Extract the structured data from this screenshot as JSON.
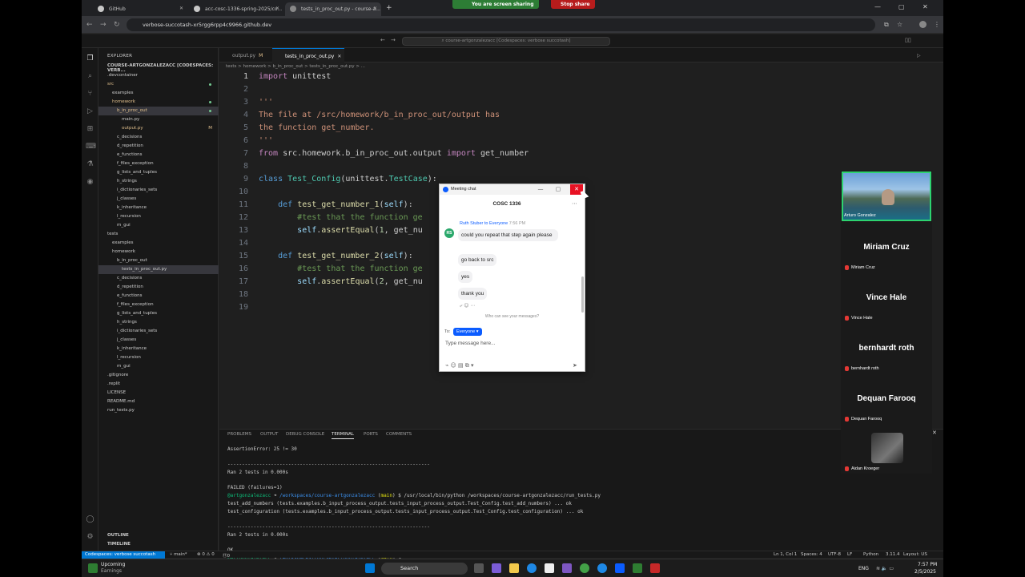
{
  "browser": {
    "tabs": [
      {
        "label": "GitHub"
      },
      {
        "label": "acc-cosc-1336-spring-2025/co..."
      },
      {
        "label": "tests_in_proc_out.py - course-a..."
      }
    ],
    "screen_share": {
      "label": "You are screen sharing",
      "stop_label": "Stop share"
    },
    "url": "verbose-succotash-xr5rgg6rpp4c9966.github.dev"
  },
  "vscode": {
    "command_center": "course-artgonzalezacc [Codespaces: verbose succotash]",
    "explorer_title": "EXPLORER",
    "workspace": "COURSE-ARTGONZALEZACC [CODESPACES: VERB...",
    "tree": [
      {
        "label": ".devcontainer",
        "indent": 0
      },
      {
        "label": "src",
        "indent": 0,
        "dot": true,
        "color": "#e2c08d"
      },
      {
        "label": "examples",
        "indent": 1
      },
      {
        "label": "homework",
        "indent": 1,
        "dot": true,
        "color": "#e2c08d"
      },
      {
        "label": "b_in_proc_out",
        "indent": 2,
        "dot": true,
        "color": "#e2c08d",
        "sel": true
      },
      {
        "label": "main.py",
        "indent": 3
      },
      {
        "label": "output.py",
        "indent": 3,
        "badge": "M",
        "color": "#e2c08d"
      },
      {
        "label": "c_decisions",
        "indent": 2
      },
      {
        "label": "d_repetition",
        "indent": 2
      },
      {
        "label": "e_functions",
        "indent": 2
      },
      {
        "label": "f_files_exception",
        "indent": 2
      },
      {
        "label": "g_lists_and_tuples",
        "indent": 2
      },
      {
        "label": "h_strings",
        "indent": 2
      },
      {
        "label": "i_dictionaries_sets",
        "indent": 2
      },
      {
        "label": "j_classes",
        "indent": 2
      },
      {
        "label": "k_inheritance",
        "indent": 2
      },
      {
        "label": "l_recursion",
        "indent": 2
      },
      {
        "label": "m_gui",
        "indent": 2
      },
      {
        "label": "tests",
        "indent": 0
      },
      {
        "label": "examples",
        "indent": 1
      },
      {
        "label": "homework",
        "indent": 1
      },
      {
        "label": "b_in_proc_out",
        "indent": 2
      },
      {
        "label": "tests_in_proc_out.py",
        "indent": 3,
        "sel": true
      },
      {
        "label": "c_decisions",
        "indent": 2
      },
      {
        "label": "d_repetition",
        "indent": 2
      },
      {
        "label": "e_functions",
        "indent": 2
      },
      {
        "label": "f_files_exception",
        "indent": 2
      },
      {
        "label": "g_lists_and_tuples",
        "indent": 2
      },
      {
        "label": "h_strings",
        "indent": 2
      },
      {
        "label": "i_dictionaries_sets",
        "indent": 2
      },
      {
        "label": "j_classes",
        "indent": 2
      },
      {
        "label": "k_inheritance",
        "indent": 2
      },
      {
        "label": "l_recursion",
        "indent": 2
      },
      {
        "label": "m_gui",
        "indent": 2
      },
      {
        "label": ".gitignore",
        "indent": 0
      },
      {
        "label": ".replit",
        "indent": 0
      },
      {
        "label": "LICENSE",
        "indent": 0
      },
      {
        "label": "README.md",
        "indent": 0
      },
      {
        "label": "run_tests.py",
        "indent": 0
      }
    ],
    "outline_label": "OUTLINE",
    "timeline_label": "TIMELINE",
    "editor_tabs": [
      {
        "label": "output.py",
        "mod": "M"
      },
      {
        "label": "tests_in_proc_out.py",
        "mod": ""
      }
    ],
    "breadcrumb": "tests > homework > b_in_proc_out > tests_in_proc_out.py > ...",
    "code_lines": [
      "<span class='kw'>import</span> unittest",
      "",
      "<span class='str'>'''</span>",
      "<span class='str'>The file at /src/homework/b_in_proc_out/output has</span>",
      "<span class='str'>the function get_number.</span>",
      "<span class='str'>'''</span>",
      "<span class='kw'>from</span> src.homework.b_in_proc_out.output <span class='kw'>import</span> get_number",
      "",
      "<span class='kw2'>class</span> <span class='cls'>Test_Config</span>(unittest.<span class='cls'>TestCase</span>):",
      "",
      "    <span class='kw2'>def</span> <span class='fn'>test_get_number_1</span>(<span class='var'>self</span>):",
      "        <span class='cm'>#test that the function ge</span>",
      "        <span class='var'>self</span>.<span class='fn'>assertEqual</span>(<span class='num'>1</span>, get_nu",
      "",
      "    <span class='kw2'>def</span> <span class='fn'>test_get_number_2</span>(<span class='var'>self</span>):",
      "        <span class='cm'>#test that the function ge</span>",
      "        <span class='var'>self</span>.<span class='fn'>assertEqual</span>(<span class='num'>2</span>, get_nu",
      "",
      ""
    ],
    "panel_tabs": [
      "PROBLEMS",
      "OUTPUT",
      "DEBUG CONSOLE",
      "TERMINAL",
      "PORTS",
      "COMMENTS"
    ],
    "terminal_lines": [
      "AssertionError: 25 != 30",
      "",
      "----------------------------------------------------------------------",
      "Ran 2 tests in 0.000s",
      "",
      "FAILED (failures=1)",
      "<span class='g'>@artgonzalezacc</span> ➜ <span class='b'>/workspaces/course-artgonzalezacc</span> (<span class='y'>main</span>) $ /usr/local/bin/python /workspaces/course-artgonzalezacc/run_tests.py",
      "test_add_numbers (tests.examples.b_input_process_output.tests_input_process_output.Test_Config.test_add_numbers) ... ok",
      "test_configuration (tests.examples.b_input_process_output.tests_input_process_output.Test_Config.test_configuration) ... ok",
      "",
      "----------------------------------------------------------------------",
      "Ran 2 tests in 0.000s",
      "",
      "OK",
      "<span class='g'>@artgonzalezacc</span> ➜ <span class='b'>/workspaces/course-artgonzalezacc</span> (<span class='y'>main</span>) $ "
    ],
    "status": {
      "remote": "Codespaces: verbose succotash",
      "branch": "main*",
      "problems": "⊗ 0 ⚠ 0",
      "ports": "⑰0",
      "position": "Ln 1, Col 1",
      "spaces": "Spaces: 4",
      "encoding": "UTF-8",
      "eol": "LF",
      "language": "Python",
      "python_ver": "3.11.4",
      "layout": "Layout: US"
    }
  },
  "zoom": {
    "self_name": "Arturo Gonzalez",
    "participants": [
      {
        "name": "Miriam Cruz"
      },
      {
        "name": "Vince Hale"
      },
      {
        "name": "bernhardt roth"
      },
      {
        "name": "Dequan Farooq"
      }
    ],
    "last_participant": "Aidan Kroeger"
  },
  "chat": {
    "window_title": "Meeting chat",
    "title": "COSC 1336",
    "sender": "Ruth Stuber",
    "to": "to Everyone",
    "time": "7:56 PM",
    "avatar": "RS",
    "messages": [
      "could you repeat that step again please",
      "go back to src",
      "yes",
      "thank you"
    ],
    "who_can_see": "Who can see your messages?",
    "to_label": "To:",
    "recipient": "Everyone",
    "placeholder": "Type message here..."
  },
  "taskbar": {
    "weather_title": "Upcoming",
    "weather_sub": "Earnings",
    "search": "Search",
    "lang": "ENG",
    "time": "7:57 PM",
    "date": "2/5/2025"
  }
}
